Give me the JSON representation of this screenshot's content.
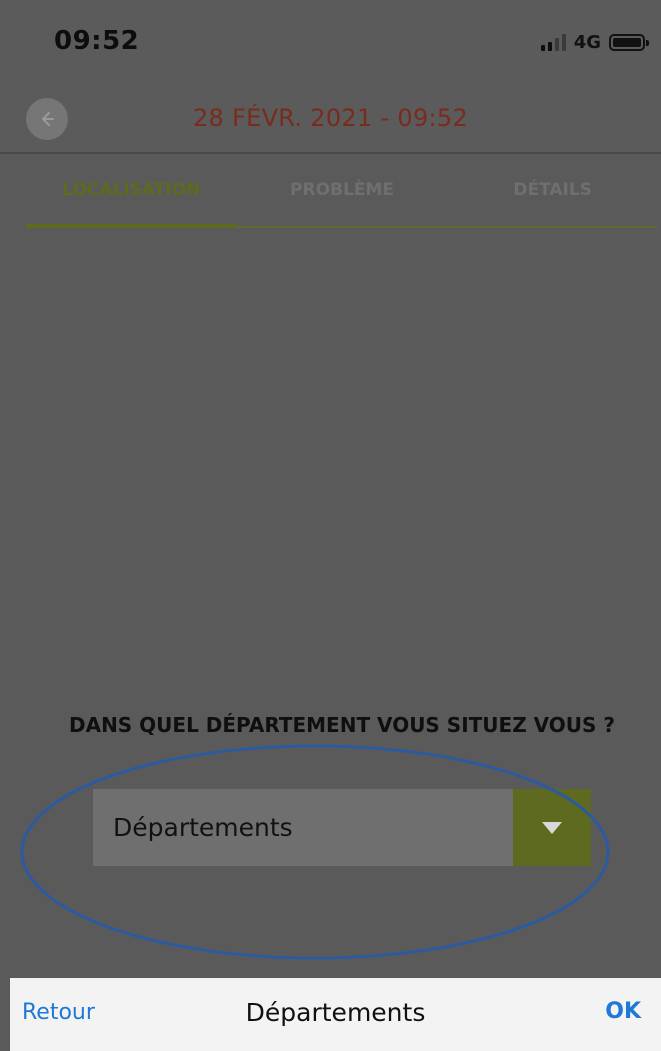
{
  "status_bar": {
    "time": "09:52",
    "network": "4G"
  },
  "header": {
    "title": "28 FÉVR. 2021 - 09:52"
  },
  "tabs": [
    {
      "label": "LOCALISATION",
      "active": true
    },
    {
      "label": "PROBLÈME",
      "active": false
    },
    {
      "label": "DÉTAILS",
      "active": false
    }
  ],
  "form": {
    "question": "DANS QUEL DÉPARTEMENT VOUS SITUEZ VOUS ?",
    "select": {
      "value": "Départements"
    }
  },
  "picker": {
    "cancel_label": "Retour",
    "title": "Départements",
    "confirm_label": "OK"
  },
  "colors": {
    "accent": "#5d6a1f",
    "title": "#7a2b1d",
    "link": "#1e78d6",
    "annotation": "#2c5aa0"
  },
  "icons": {
    "back": "arrow-left-icon",
    "dropdown": "triangle-down-icon",
    "signal": "cellular-signal-icon",
    "battery": "battery-icon"
  }
}
